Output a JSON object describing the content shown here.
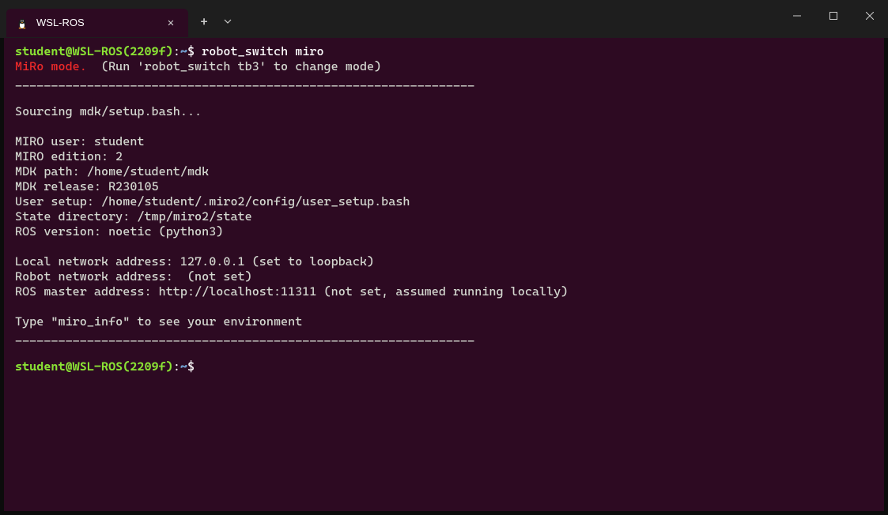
{
  "titlebar": {
    "tab_title": "WSL-ROS",
    "close_symbol": "✕",
    "new_tab_symbol": "+",
    "dropdown_symbol": "⌄"
  },
  "window_controls": {
    "minimize": "─",
    "maximize": "☐",
    "close": "✕"
  },
  "terminal": {
    "prompt1_user": "student@WSL-ROS(2209f)",
    "prompt1_colon": ":",
    "prompt1_path": "~",
    "prompt1_dollar": "$ ",
    "prompt1_cmd": "robot_switch miro",
    "miro_mode": "MiRo mode.",
    "miro_mode_note": "  (Run 'robot_switch tb3' to change mode)",
    "divider1": "________________________________________________________________",
    "sourcing": "Sourcing mdk/setup.bash...",
    "miro_user": "MIRO user: student",
    "miro_edition": "MIRO edition: 2",
    "mdk_path": "MDK path: /home/student/mdk",
    "mdk_release": "MDK release: R230105",
    "user_setup": "User setup: /home/student/.miro2/config/user_setup.bash",
    "state_dir": "State directory: /tmp/miro2/state",
    "ros_version": "ROS version: noetic (python3)",
    "local_net": "Local network address: 127.0.0.1 (set to loopback)",
    "robot_net": "Robot network address:  (not set)",
    "ros_master": "ROS master address: http://localhost:11311 (not set, assumed running locally)",
    "type_info": "Type \"miro_info\" to see your environment",
    "divider2": "________________________________________________________________",
    "prompt2_user": "student@WSL-ROS(2209f)",
    "prompt2_colon": ":",
    "prompt2_path": "~",
    "prompt2_dollar": "$"
  }
}
